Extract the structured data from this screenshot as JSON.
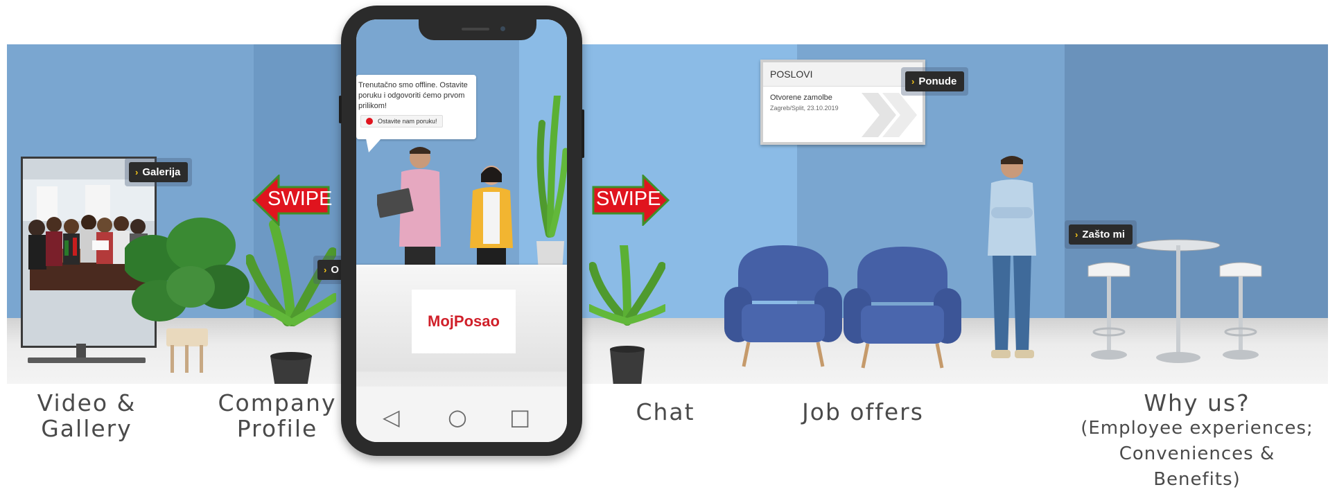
{
  "tags": {
    "galerija": "Galerija",
    "o_nama": "O nama",
    "ponude": "Ponude",
    "zasto_mi": "Zašto mi"
  },
  "swipe_left": "SWIPE",
  "swipe_right": "SWIPE",
  "job_board": {
    "heading": "POSLOVI",
    "title": "Otvorene zamolbe",
    "subtitle": "Zagreb/Split, 23.10.2019"
  },
  "phone": {
    "chat_message": "Trenutačno smo offline. Ostavite poruku i odgovoriti ćemo prvom prilikom!",
    "chat_button": "Ostavite nam poruku!",
    "brand": "MojPosao",
    "nav": {
      "back": "◁",
      "home": "○",
      "recent": "□"
    }
  },
  "captions": {
    "video_gallery": {
      "line1": "Video &",
      "line2": "Gallery"
    },
    "company_profile": {
      "line1": "Company",
      "line2": "Profile"
    },
    "chat": "Chat",
    "job_offers": "Job offers",
    "why_us": {
      "line1": "Why us?",
      "line2": "(Employee experiences;",
      "line3": "Conveniences &",
      "line4": "Benefits)"
    }
  },
  "colors": {
    "wall": "#7aa6d0",
    "swipe_red": "#e0141e",
    "swipe_green": "#3f8f2a",
    "brand_red": "#d0202a",
    "chair_blue": "#3c5597"
  },
  "icons": [
    "chevron-right-icon",
    "back-triangle-icon",
    "home-circle-icon",
    "recent-square-icon",
    "chat-status-dot-icon"
  ]
}
